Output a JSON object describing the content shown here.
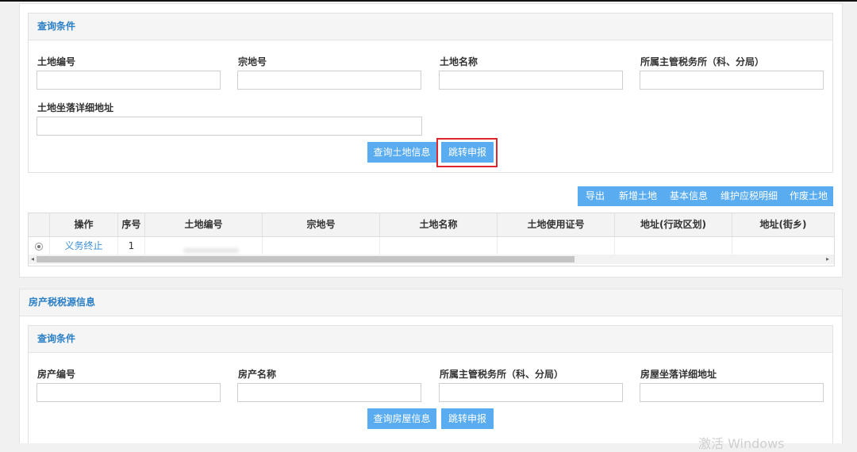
{
  "land_section": {
    "query_title": "查询条件",
    "fields": [
      {
        "label": "土地编号",
        "value": ""
      },
      {
        "label": "宗地号",
        "value": ""
      },
      {
        "label": "土地名称",
        "value": ""
      },
      {
        "label": "所属主管税务所（科、分局）",
        "value": ""
      },
      {
        "label": "土地坐落详细地址",
        "value": ""
      }
    ],
    "query_button": "查询土地信息",
    "jump_button": "跳转申报",
    "toolbar": [
      "导出",
      "新增土地",
      "基本信息",
      "维护应税明细",
      "作废土地"
    ],
    "table": {
      "headers": [
        "操作",
        "序号",
        "土地编号",
        "宗地号",
        "土地名称",
        "土地使用证号",
        "地址(行政区划)",
        "地址(街乡)"
      ],
      "rows": [
        {
          "action": "义务终止",
          "index": "1"
        }
      ]
    }
  },
  "house_section": {
    "title": "房产税税源信息",
    "query_title": "查询条件",
    "fields": [
      {
        "label": "房产编号",
        "value": ""
      },
      {
        "label": "房产名称",
        "value": ""
      },
      {
        "label": "所属主管税务所（科、分局）",
        "value": ""
      },
      {
        "label": "房屋坐落详细地址",
        "value": ""
      }
    ],
    "query_button": "查询房屋信息",
    "jump_button": "跳转申报"
  },
  "watermark": "激活 Windows",
  "colors": {
    "accent": "#5aacf0",
    "title_blue": "#2a7fc6",
    "highlight": "#e0262a"
  }
}
